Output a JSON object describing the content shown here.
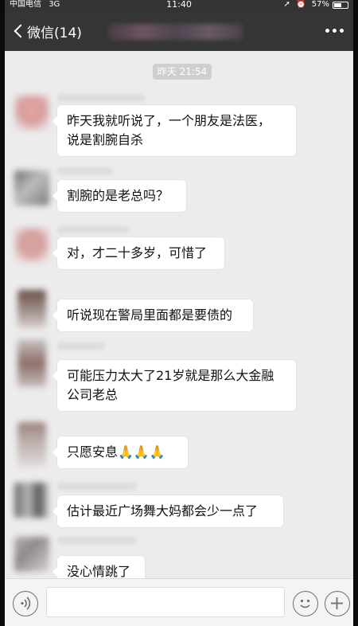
{
  "status_bar": {
    "carrier": "中国电信",
    "network": "3G",
    "time": "11:40",
    "battery_percent": "57%",
    "battery_level": 0.57
  },
  "header": {
    "back_label": "微信(14)",
    "title": ""
  },
  "chat": {
    "timestamp": "昨天 21:54",
    "messages": [
      {
        "lines": [
          "昨天我就听说了，一个朋友是法医，",
          "说是割腕自杀"
        ]
      },
      {
        "lines": [
          "割腕的是老总吗？"
        ]
      },
      {
        "lines": [
          "对，才二十多岁，可惜了"
        ]
      },
      {
        "lines": [
          "听说现在警局里面都是要债的"
        ]
      },
      {
        "lines": [
          "可能压力太大了21岁就是那么大金融",
          "公司老总"
        ]
      },
      {
        "lines": [
          "只愿安息🙏🙏🙏"
        ]
      },
      {
        "lines": [
          "估计最近广场舞大妈都会少一点了"
        ]
      },
      {
        "lines": [
          "没心情跳了"
        ]
      }
    ]
  },
  "input_bar": {
    "icons": [
      "voice-icon",
      "emoji-icon",
      "plus-icon"
    ],
    "text_value": ""
  },
  "colors": {
    "nav_background": "#353535",
    "chat_background": "#ececec",
    "bubble_background": "#ffffff",
    "timestamp_pill": "#cfcfcf"
  }
}
